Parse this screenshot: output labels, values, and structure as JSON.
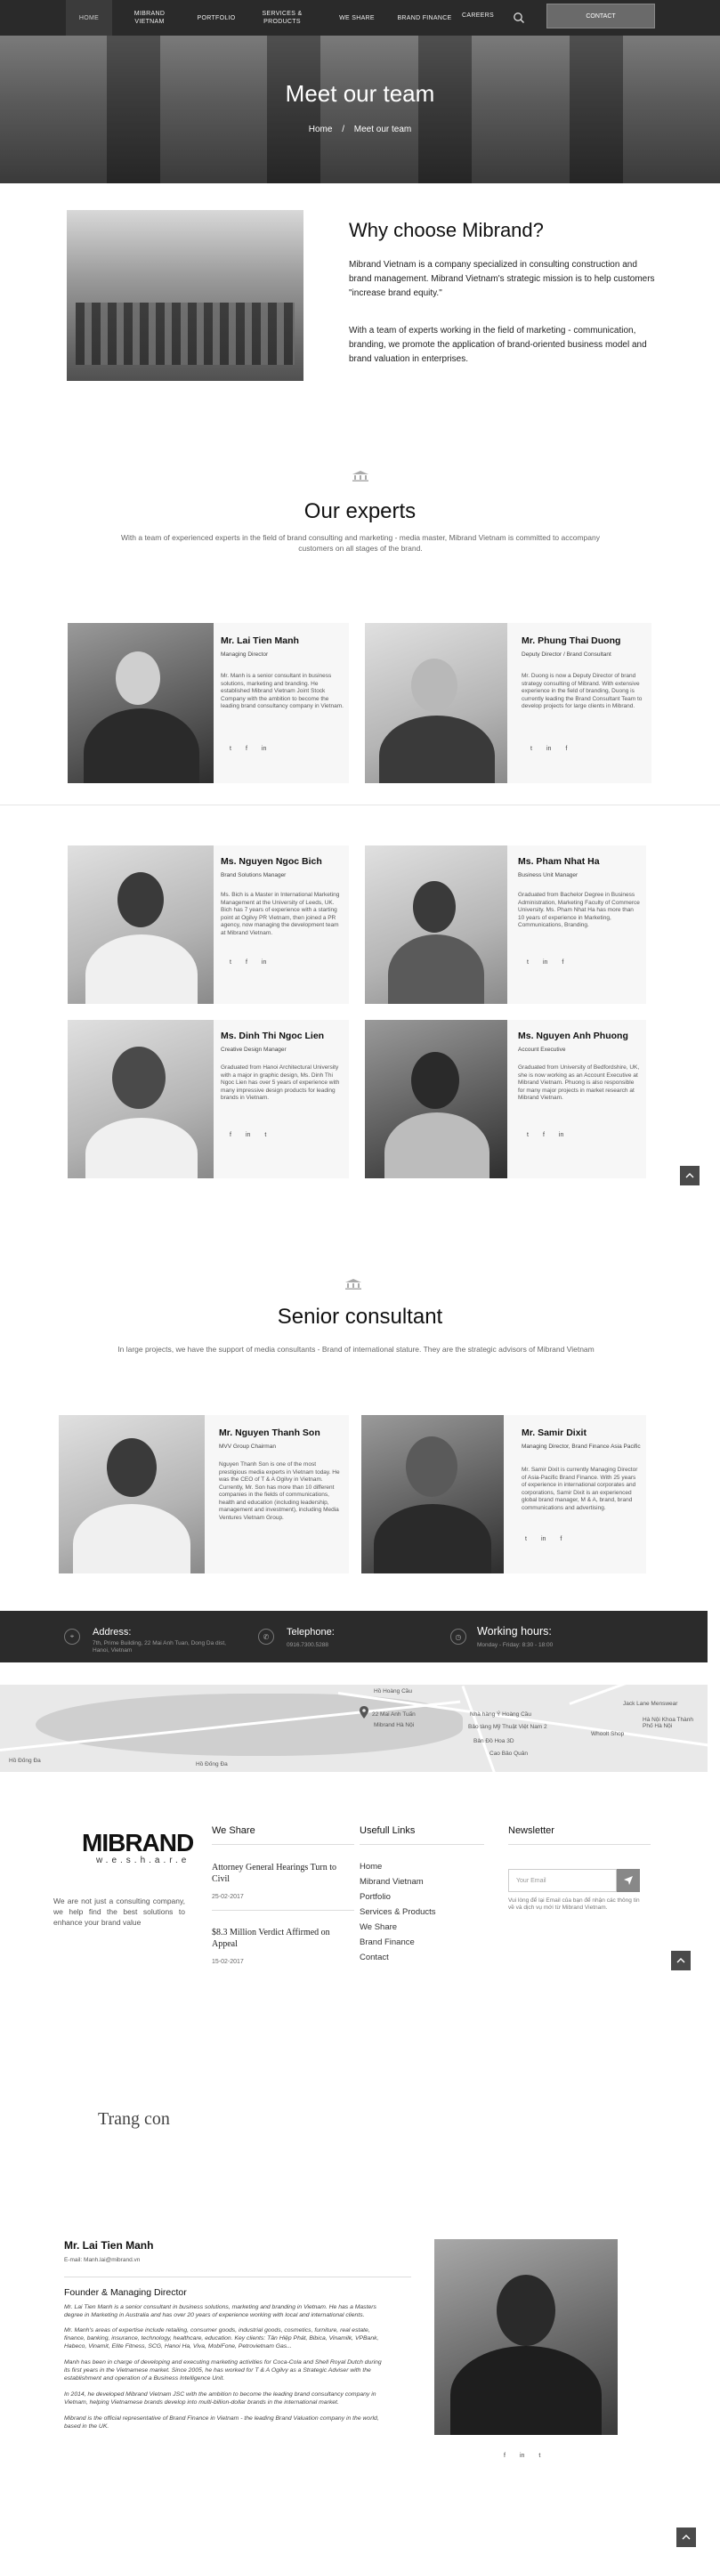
{
  "nav": {
    "items": [
      "HOME",
      "MIBRAND VIETNAM",
      "PORTFOLIO",
      "SERVICES & PRODUCTS",
      "WE SHARE",
      "BRAND FINANCE",
      "CAREERS"
    ],
    "contact": "CONTACT"
  },
  "hero": {
    "title": "Meet our team",
    "crumb_home": "Home",
    "crumb_sep": "/",
    "crumb_current": "Meet our team"
  },
  "why": {
    "title": "Why choose Mibrand?",
    "p1": "Mibrand Vietnam is a company specialized in consulting construction and brand management. Mibrand Vietnam's strategic mission is to help customers \"increase brand equity.\"",
    "p2": "With a team of experts working in the field of marketing - communication, branding, we promote the application of brand-oriented business model and brand valuation in enterprises."
  },
  "experts": {
    "title": "Our experts",
    "subtitle": "With a team of experienced experts in the field of brand consulting and marketing - media master, Mibrand Vietnam is committed to accompany customers on all stages of the brand.",
    "cards": [
      {
        "name": "Mr. Lai Tien Manh",
        "role": "Managing Director",
        "text": "Mr. Manh is a senior consultant in business solutions, marketing and branding. He established Mibrand Vietnam Joint Stock Company with the ambition to become the leading brand consultancy company in Vietnam.",
        "social": [
          "t",
          "f",
          "in"
        ]
      },
      {
        "name": "Mr. Phung Thai Duong",
        "role": "Deputy Director / Brand Consultant",
        "text": "Mr. Duong is now a Deputy Director of brand strategy consulting of Mibrand. With extensive experience in the field of branding, Duong is currently leading the Brand Consultant Team to develop projects for large clients in Mibrand.",
        "social": [
          "t",
          "in",
          "f"
        ]
      },
      {
        "name": "Ms. Nguyen Ngoc Bich",
        "role": "Brand Solutions Manager",
        "text": "Ms. Bich is a Master in International Marketing Management at the University of Leeds, UK. Bich has 7 years of experience with a starting point at Ogilvy PR Vietnam, then joined a PR agency, now managing the development team at Mibrand Vietnam.",
        "social": [
          "t",
          "f",
          "in"
        ]
      },
      {
        "name": "Ms. Pham Nhat Ha",
        "role": "Business Unit Manager",
        "text": "Graduated from Bachelor Degree in Business Administration, Marketing Faculty of Commerce University. Ms. Pham Nhat Ha has more than 10 years of experience in Marketing, Communications, Branding.",
        "social": [
          "t",
          "in",
          "f"
        ]
      },
      {
        "name": "Ms. Dinh Thi Ngoc Lien",
        "role": "Creative Design Manager",
        "text": "Graduated from Hanoi Architectural University with a major in graphic design, Ms. Dinh Thi Ngoc Lien has over 5 years of experience with many impressive design products for leading brands in Vietnam.",
        "social": [
          "f",
          "in",
          "t"
        ]
      },
      {
        "name": "Ms. Nguyen Anh Phuong",
        "role": "Account Executive",
        "text": "Graduated from University of Bedfordshire, UK, she is now working as an Account Executive at Mibrand Vietnam. Phuong is also responsible for many major projects in market research at Mibrand Vietnam.",
        "social": [
          "t",
          "f",
          "in"
        ]
      }
    ]
  },
  "senior": {
    "title": "Senior consultant",
    "subtitle": "In large projects, we have the support of media consultants - Brand of international stature. They are the strategic advisors of Mibrand Vietnam",
    "cards": [
      {
        "name": "Mr. Nguyen Thanh Son",
        "role": "MVV Group Chairman",
        "text": "Nguyen Thanh Son is one of the most prestigious media experts in Vietnam today. He was the CEO of T & A Ogilvy in Vietnam. Currently, Mr. Son has more than 10 different companies in the fields of communications, health and education (including leadership, management and investment), including Media Ventures Vietnam Group.",
        "social": []
      },
      {
        "name": "Mr. Samir Dixit",
        "role": "Managing Director, Brand Finance Asia Pacific",
        "text": "Mr. Samir Dixit is currently Managing Director of Asia-Pacific Brand Finance. With 25 years of experience in international corporates and corporations, Samir Dixit is an experienced global brand manager, M & A, brand, brand communications and advertising.",
        "social": [
          "t",
          "in",
          "f"
        ]
      }
    ]
  },
  "contact_bar": {
    "address_title": "Address:",
    "address": "7th, Prime Building, 22 Mai Anh Tuan, Dong Da dist, Hanoi, Vietnam",
    "phone_title": "Telephone:",
    "phone": "0916.7300.5288",
    "hours_title": "Working hours:",
    "hours": "Monday - Friday: 8:30 - 18:00"
  },
  "map": {
    "labels": [
      "Hồ Đống Đa",
      "22 Mai Anh Tuấn",
      "Nhà hàng Ý Hoàng Cầu",
      "Bảo tàng Mỹ Thuật Việt Nam 2",
      "Cao Bảo Quân",
      "Hà Nội Khoa Thành Phố Hà Nội",
      "Jack Lane Menswear",
      "Mibrand Hà Nội",
      "Bản Đồ Hoa 3D",
      "Whoolt Shop",
      "Bảo Tàng Mỹ Thuật Việt Nam",
      "Hồ Hoàng Cầu"
    ]
  },
  "footer": {
    "logo": "MIBRAND",
    "logo_sub": "w.e.s.h.a.r.e",
    "about": "We are not just a consulting company, we help find the best solutions to enhance your brand value",
    "we_share_title": "We Share",
    "posts": [
      {
        "title": "Attorney General Hearings Turn to Civil",
        "date": "25-02-2017"
      },
      {
        "title": "$8.3 Million Verdict Affirmed on Appeal",
        "date": "15-02-2017"
      }
    ],
    "links_title": "Usefull Links",
    "links": [
      "Home",
      "Mibrand Vietnam",
      "Portfolio",
      "Services & Products",
      "We Share",
      "Brand Finance",
      "Contact"
    ],
    "newsletter_title": "Newsletter",
    "email_placeholder": "Your Email",
    "newsletter_note": "Vui lòng để lại Email của bạn để nhận các thông tin về và dịch vụ mới từ Mibrand Vietnam."
  },
  "trang_con": "Trang con",
  "detail": {
    "name": "Mr. Lai Tien Manh",
    "email": "E-mail: Manh.lai@mibrand.vn",
    "role": "Founder & Managing Director",
    "paragraphs": [
      "Mr. Lai Tien Manh is a senior consultant in business solutions, marketing and branding in Vietnam. He has a Masters degree in Marketing in Australia and has over 20 years of experience working with local and international clients.",
      "Mr. Manh's areas of expertise include retailing, consumer goods, industrial goods, cosmetics, furniture, real estate, finance, banking, insurance, technology, healthcare, education. Key clients: Tân Hiệp Phát, Bibica, Vinamilk, VPBank, Habeco, Vinamit, Elite Fitness, SCG, Hanoi Ha, Viva, MobiFone, Petrovietnam Gas...",
      "Manh has been in charge of developing and executing marketing activities for Coca-Cola and Shell Royal Dutch during its first years in the Vietnamese market. Since 2005, he has worked for T & A Ogilvy as a Strategic Adviser with the establishment and operation of a Business Intelligence Unit.",
      "In 2014, he developed Mibrand Vietnam JSC with the ambition to become the leading brand consultancy company in Vietnam, helping Vietnamese brands develop into multi-billion-dollar brands in the international market.",
      "Mibrand is the official representative of Brand Finance in Vietnam - the leading Brand Valuation company in the world, based in the UK."
    ],
    "social": [
      "f",
      "in",
      "t"
    ]
  }
}
